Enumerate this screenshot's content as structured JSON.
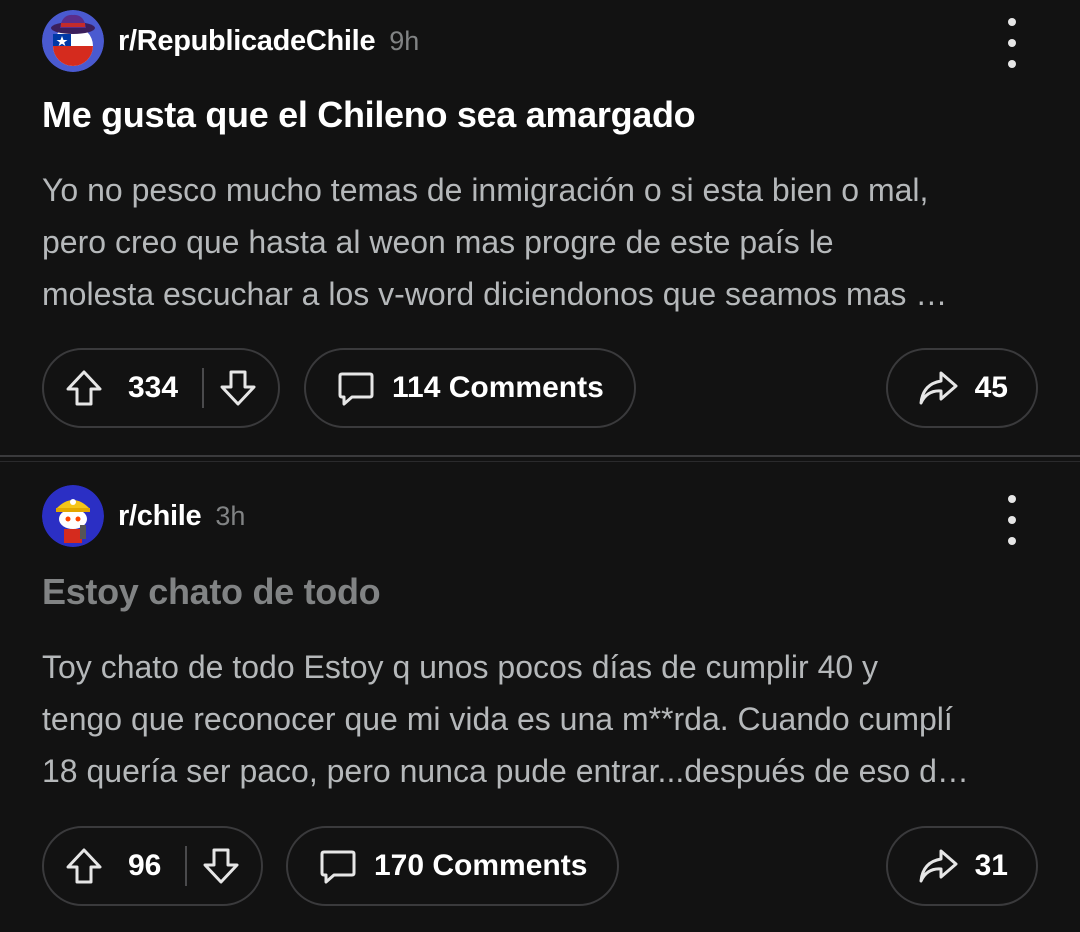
{
  "posts": [
    {
      "subreddit": "r/RepublicadeChile",
      "age": "9h",
      "title": "Me gusta que el Chileno sea amargado",
      "body_lines": [
        "Yo no pesco mucho temas de inmigración o si esta bien o mal,",
        "pero creo que hasta al weon mas progre de este país le",
        "molesta escuchar a los v-word diciendonos que seamos mas …"
      ],
      "votes": "334",
      "comments": "114 Comments",
      "shares": "45"
    },
    {
      "subreddit": "r/chile",
      "age": "3h",
      "title": "Estoy chato de todo",
      "body_lines": [
        "Toy chato de todo Estoy q unos pocos días de cumplir 40 y",
        "tengo que reconocer que mi vida es una m**rda. Cuando cumplí",
        "18 quería ser paco, pero nunca pude entrar...después de eso d…"
      ],
      "votes": "96",
      "comments": "170 Comments",
      "shares": "31"
    }
  ],
  "icons": {
    "upvote": "upvote-arrow-icon",
    "downvote": "downvote-arrow-icon",
    "comment": "speech-bubble-icon",
    "share": "share-arrow-icon",
    "more": "vertical-ellipsis-icon"
  },
  "colors": {
    "background": "#121212",
    "title": "#ffffff",
    "title_read": "#818384",
    "body": "#b5b8ba",
    "meta": "#818384",
    "pill_border": "#3a3a3c"
  }
}
